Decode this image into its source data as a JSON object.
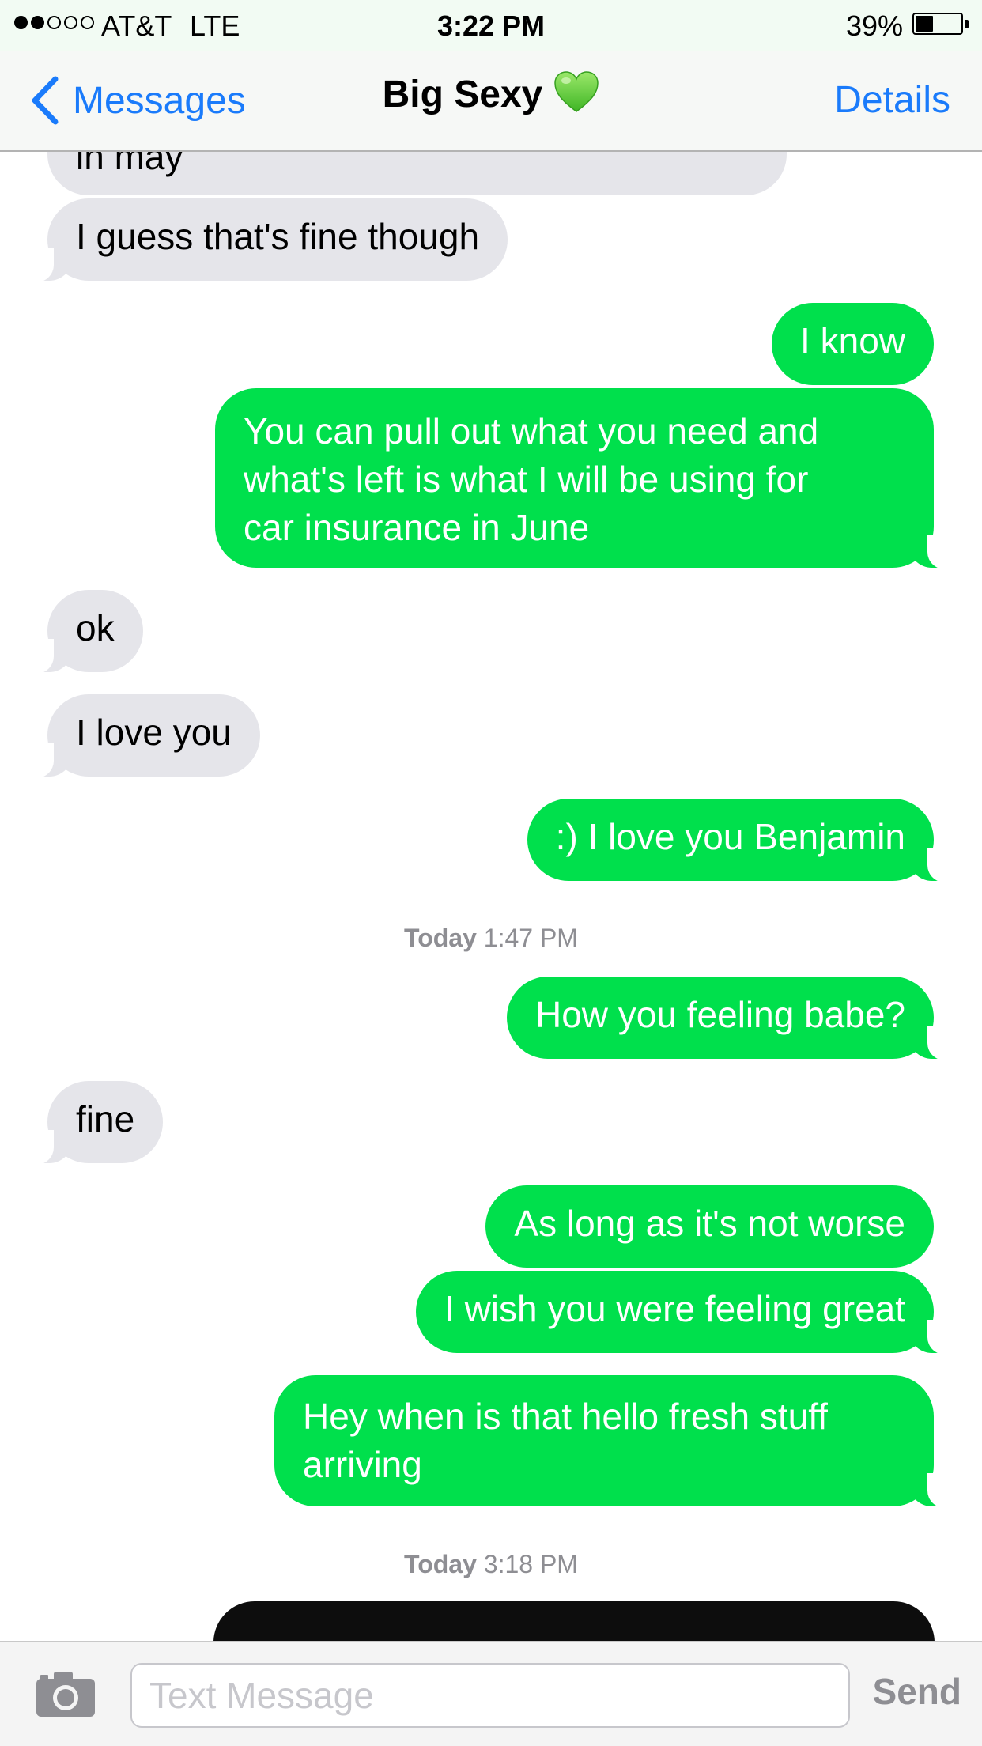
{
  "status_bar": {
    "carrier": "AT&T",
    "network": "LTE",
    "time": "3:22 PM",
    "battery_pct": "39%",
    "battery_level": 0.39,
    "signal_bars_filled": 2,
    "signal_bars_total": 5
  },
  "nav": {
    "back_label": "Messages",
    "title": "Big Sexy",
    "title_icon": "green-heart-icon",
    "details_label": "Details"
  },
  "conversation": {
    "messages": [
      {
        "text": "in may",
        "direction": "in"
      },
      {
        "text": "I guess that's fine though",
        "direction": "in"
      },
      {
        "text": "I know",
        "direction": "out"
      },
      {
        "text": "You can pull out what you need and what's left is what I will be using for car insurance in June",
        "direction": "out",
        "lines": [
          "You can pull out what you need and",
          "what's left is what I will be using for",
          "car insurance in June"
        ]
      },
      {
        "text": "ok",
        "direction": "in"
      },
      {
        "text": "I love you",
        "direction": "in"
      },
      {
        "text": ":) I love you Benjamin",
        "direction": "out"
      },
      {
        "text": "How you feeling babe?",
        "direction": "out"
      },
      {
        "text": "fine",
        "direction": "in"
      },
      {
        "text": "As long as it's not worse",
        "direction": "out"
      },
      {
        "text": "I wish you were feeling great",
        "direction": "out"
      },
      {
        "text": "Hey when is that hello fresh stuff arriving",
        "direction": "out",
        "lines": [
          "Hey when is that hello fresh stuff",
          "arriving"
        ]
      }
    ],
    "timestamps": [
      {
        "day": "Today",
        "time": "1:47 PM"
      },
      {
        "day": "Today",
        "time": "3:18 PM"
      }
    ]
  },
  "input_bar": {
    "placeholder": "Text Message",
    "send_label": "Send",
    "camera_icon": "camera-icon"
  },
  "colors": {
    "outgoing_bubble": "#00e04c",
    "incoming_bubble": "#e5e5ea",
    "accent": "#1a7bfb",
    "timestamp": "#8e8e93"
  }
}
